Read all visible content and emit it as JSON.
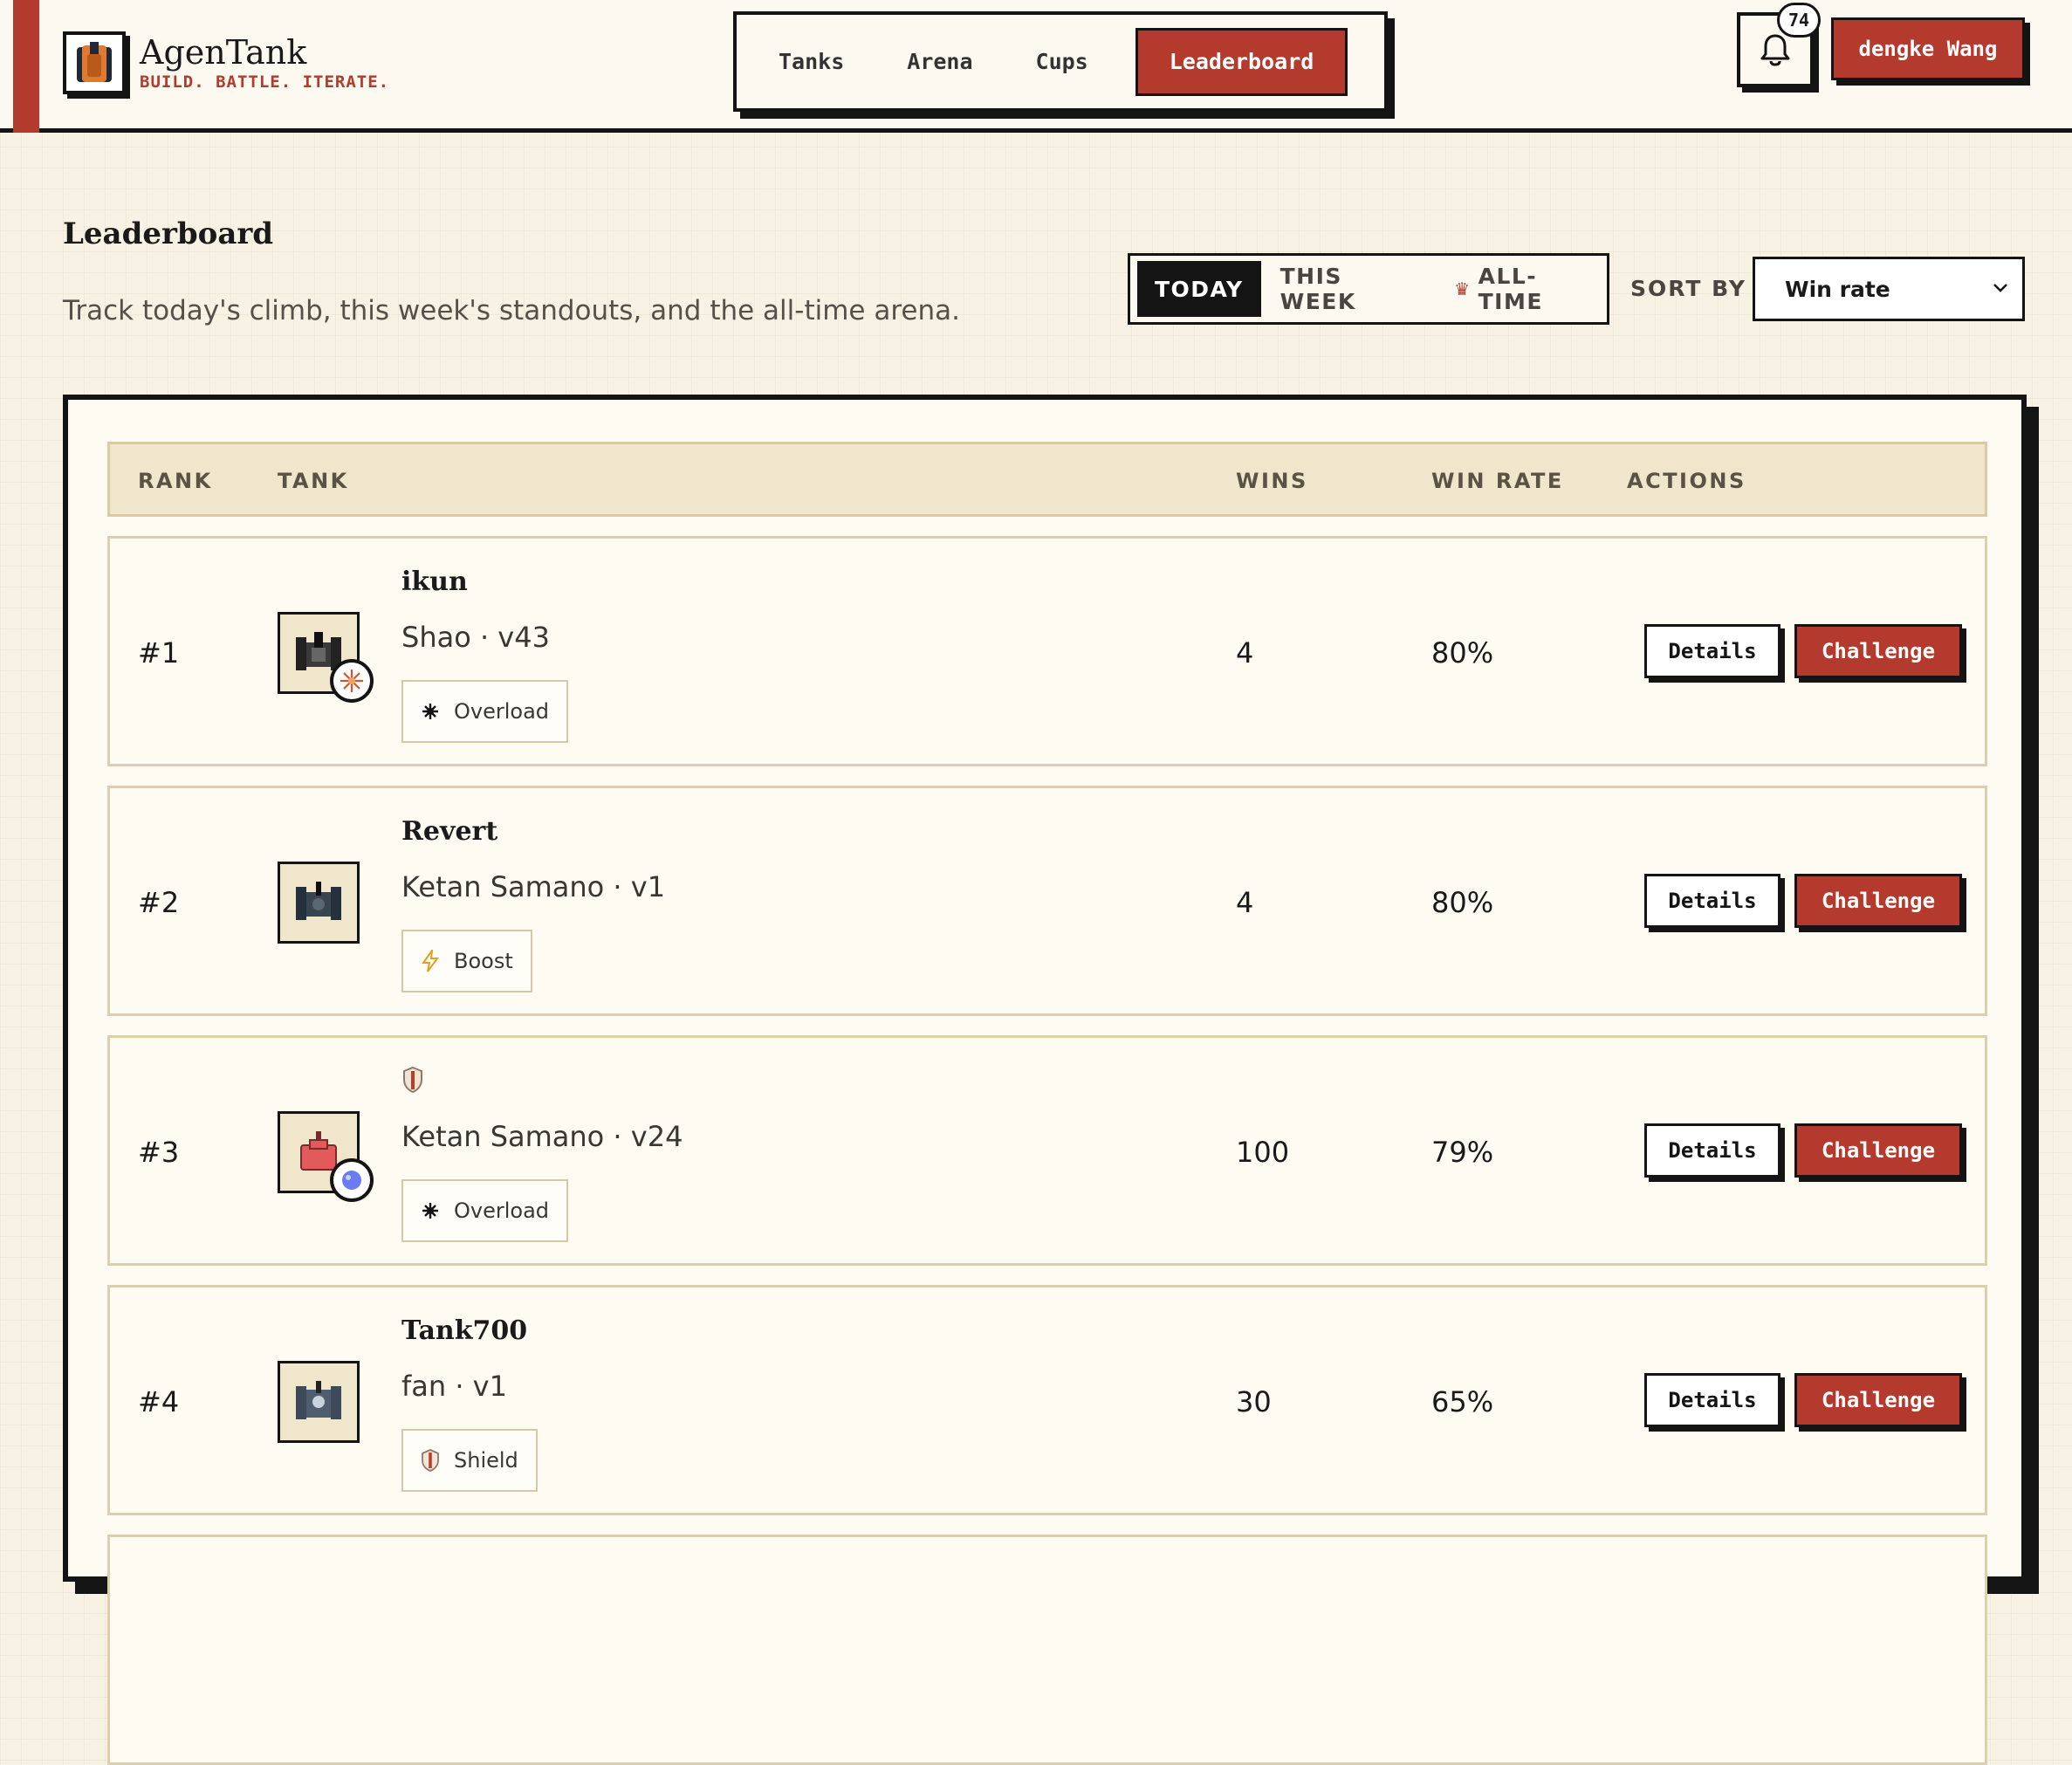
{
  "brand": {
    "name": "AgenTank",
    "tagline": "BUILD. BATTLE. ITERATE.",
    "accent": "#b33a2c"
  },
  "nav": [
    {
      "label": "Tanks"
    },
    {
      "label": "Arena"
    },
    {
      "label": "Cups"
    },
    {
      "label": "Leaderboard",
      "active": true
    }
  ],
  "notifications": {
    "count": "74",
    "icon": "bell-icon"
  },
  "user": {
    "name": "dengke Wang"
  },
  "page": {
    "title": "Leaderboard",
    "subtitle": "Track today's climb, this week's standouts, and the all-time arena."
  },
  "periods": [
    {
      "label": "TODAY",
      "active": true
    },
    {
      "label": "THIS WEEK"
    },
    {
      "label": "ALL-TIME",
      "icon": "crown-icon"
    }
  ],
  "sort": {
    "label": "SORT BY",
    "selected": "Win rate"
  },
  "table": {
    "headers": {
      "rank": "RANK",
      "tank": "TANK",
      "wins": "WINS",
      "win_rate": "WIN RATE",
      "actions": "ACTIONS"
    },
    "rows": [
      {
        "rank": "#1",
        "name": "ikun",
        "owner": "Shao · v43",
        "ability": "Overload",
        "ability_icon": "burst-icon",
        "wins": "4",
        "win_rate": "80%",
        "details": "Details",
        "challenge": "Challenge"
      },
      {
        "rank": "#2",
        "name": "Revert",
        "owner": "Ketan Samano · v1",
        "ability": "Boost",
        "ability_icon": "lightning-icon",
        "wins": "4",
        "win_rate": "80%",
        "details": "Details",
        "challenge": "Challenge"
      },
      {
        "rank": "#3",
        "name": "",
        "owner": "Ketan Samano · v24",
        "ability": "Overload",
        "ability_icon": "burst-icon",
        "wins": "100",
        "win_rate": "79%",
        "details": "Details",
        "challenge": "Challenge"
      },
      {
        "rank": "#4",
        "name": "Tank700",
        "owner": "fan · v1",
        "ability": "Shield",
        "ability_icon": "shield-icon",
        "wins": "30",
        "win_rate": "65%",
        "details": "Details",
        "challenge": "Challenge"
      }
    ]
  }
}
